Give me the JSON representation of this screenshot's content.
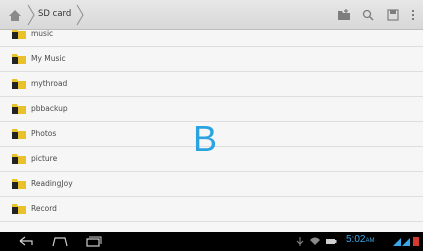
{
  "breadcrumb": {
    "current": "SD card"
  },
  "files": [
    "music",
    "My Music",
    "mythroad",
    "pbbackup",
    "Photos",
    "picture",
    "ReadingJoy",
    "Record"
  ],
  "overlay_letter": "B",
  "status": {
    "time": "5:02",
    "ampm": "AM"
  },
  "colors": {
    "accent": "#2aa4e0",
    "folder": "#e9c12a",
    "navbar": "#000000"
  },
  "icons": {
    "home": "home-icon",
    "new_folder": "new-folder-icon",
    "search": "search-icon",
    "save": "save-icon",
    "menu": "overflow-menu-icon",
    "folder": "folder-icon",
    "back": "back-icon",
    "nav_home": "home-nav-icon",
    "recent": "recent-apps-icon"
  }
}
